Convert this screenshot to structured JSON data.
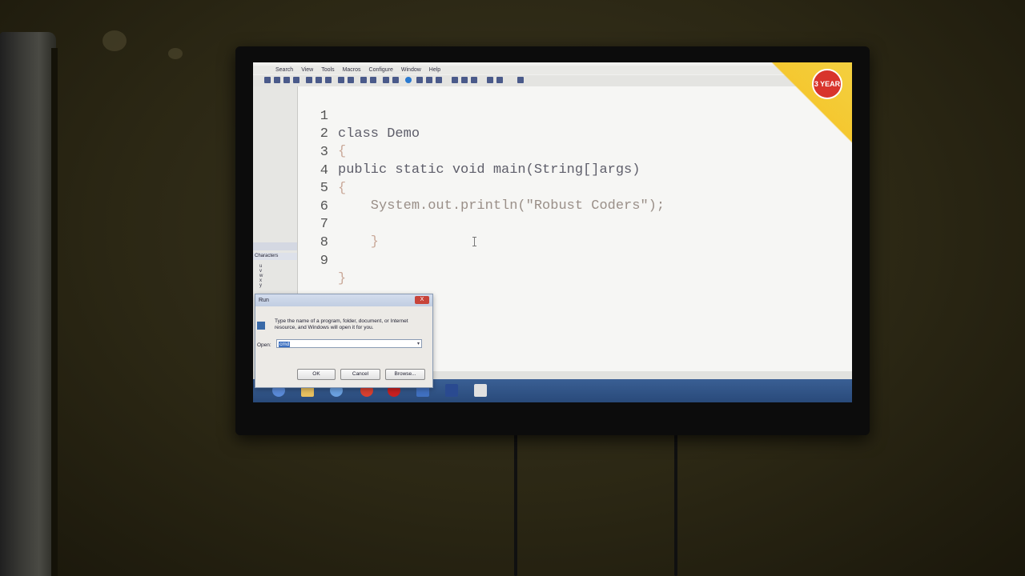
{
  "editor": {
    "lines": [
      {
        "num": "1",
        "text": "class Demo"
      },
      {
        "num": "2",
        "text": "{"
      },
      {
        "num": "3",
        "text": "public static void main(String[]args)"
      },
      {
        "num": "4",
        "text": "{"
      },
      {
        "num": "5",
        "text": "    System.out.println(\"Robust Coders\");"
      },
      {
        "num": "6",
        "text": ""
      },
      {
        "num": "7",
        "text": "    }"
      },
      {
        "num": "8",
        "text": ""
      },
      {
        "num": "9",
        "text": "}"
      }
    ]
  },
  "menu": {
    "items": [
      "Search",
      "View",
      "Tools",
      "Macros",
      "Configure",
      "Window",
      "Help"
    ]
  },
  "left_panel": {
    "characters_header": "Characters",
    "characters": [
      "u",
      "v",
      "w",
      "x",
      "y"
    ]
  },
  "promo": {
    "badge": "3 YEAR"
  },
  "run_dialog": {
    "title": "Run",
    "close": "X",
    "description": "Type the name of a program, folder, document, or Internet resource, and Windows will open it for you.",
    "open_label": "Open:",
    "input_value": "cmd",
    "ok_label": "OK",
    "cancel_label": "Cancel",
    "browse_label": "Browse..."
  },
  "colors": {
    "taskbar": "#294a7a",
    "editor_bg": "#f6f6f4",
    "code_text": "#5e5e6a",
    "promo": "#f3d040"
  }
}
